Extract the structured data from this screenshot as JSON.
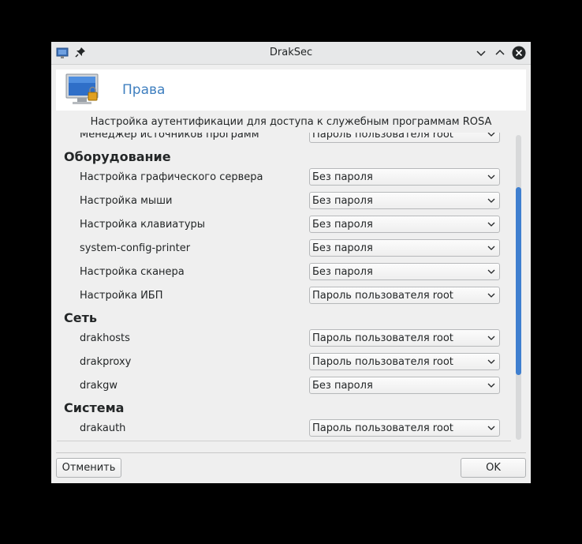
{
  "window": {
    "title": "DrakSec"
  },
  "header": {
    "title": "Права"
  },
  "subtitle": "Настройка аутентификации для доступа к служебным программам ROSA",
  "content": {
    "partial_row": {
      "label": "Менеджер источников программ",
      "value": "Пароль пользователя root"
    },
    "sections": [
      {
        "title": "Оборудование",
        "rows": [
          {
            "label": "Настройка графического сервера",
            "value": "Без пароля"
          },
          {
            "label": "Настройка мыши",
            "value": "Без пароля"
          },
          {
            "label": "Настройка клавиатуры",
            "value": "Без пароля"
          },
          {
            "label": "system-config-printer",
            "value": "Без пароля"
          },
          {
            "label": "Настройка сканера",
            "value": "Без пароля"
          },
          {
            "label": "Настройка ИБП",
            "value": "Пароль пользователя root"
          }
        ]
      },
      {
        "title": "Сеть",
        "rows": [
          {
            "label": "drakhosts",
            "value": "Пароль пользователя root"
          },
          {
            "label": "drakproxy",
            "value": "Пароль пользователя root"
          },
          {
            "label": "drakgw",
            "value": "Без пароля"
          }
        ]
      },
      {
        "title": "Система",
        "rows": [
          {
            "label": "drakauth",
            "value": "Пароль пользователя root"
          }
        ]
      }
    ]
  },
  "buttons": {
    "cancel": "Отменить",
    "ok": "OK"
  },
  "colors": {
    "accent": "#3f7fcf",
    "header_title": "#3f7fbf",
    "background": "#efefef"
  },
  "icons": [
    "app-icon",
    "pin-icon",
    "minimize-icon",
    "maximize-icon",
    "close-icon",
    "security-monitor-icon",
    "chevron-down-icon"
  ]
}
